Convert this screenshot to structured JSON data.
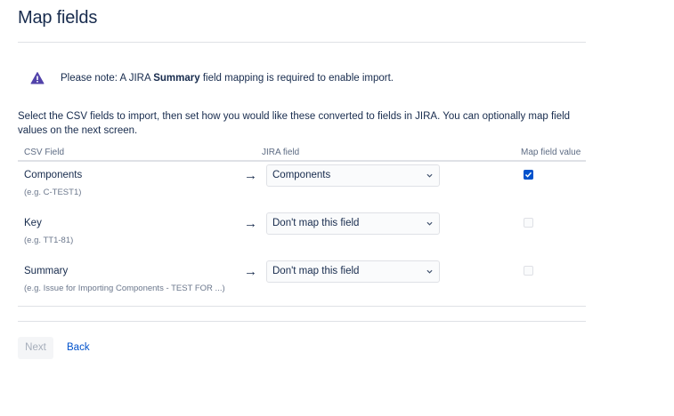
{
  "page": {
    "title": "Map fields"
  },
  "notice": {
    "prefix": "Please note: A JIRA ",
    "bold": "Summary",
    "suffix": " field mapping is required to enable import."
  },
  "intro": "Select the CSV fields to import, then set how you would like these converted to fields in JIRA. You can optionally map field values on the next screen.",
  "table": {
    "headers": {
      "csv_field": "CSV Field",
      "jira_field": "JIRA field",
      "map_value": "Map field value"
    },
    "rows": [
      {
        "name": "Components",
        "example": "(e.g. C-TEST1)",
        "arrow": "→",
        "selected": "Components",
        "map_value_checked": true
      },
      {
        "name": "Key",
        "example": "(e.g. TT1-81)",
        "arrow": "→",
        "selected": "Don't map this field",
        "map_value_checked": false
      },
      {
        "name": "Summary",
        "example": "(e.g. Issue for Importing Components - TEST FOR ...)",
        "arrow": "→",
        "selected": "Don't map this field",
        "map_value_checked": false
      }
    ]
  },
  "buttons": {
    "next": "Next",
    "back": "Back"
  },
  "colors": {
    "link": "#0052cc",
    "warning_icon": "#5243aa",
    "checkbox_checked": "#0052cc"
  },
  "icons": {
    "notice": "warning-icon",
    "select": "chevron-down-icon",
    "check": "checkmark-icon"
  }
}
